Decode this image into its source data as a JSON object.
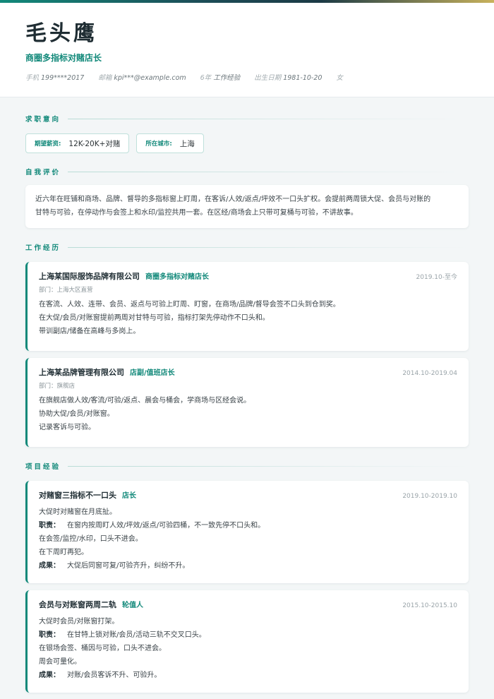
{
  "header": {
    "name": "毛头鹰",
    "title": "商圈多指标对赌店长",
    "meta": {
      "phone_label": "手机",
      "phone": "199****2017",
      "email_label": "邮箱",
      "email": "kpi***@example.com",
      "years": "6年",
      "years_label": "工作经验",
      "birth_label": "出生日期",
      "birth": "1981-10-20",
      "gender": "女"
    }
  },
  "sections": {
    "intent": "求职意向",
    "summary": "自我评价",
    "work": "工作经历",
    "projects": "项目经验"
  },
  "intent": {
    "salary_label": "期望薪资:",
    "salary": "12K-20K+对赌",
    "city_label": "所在城市:",
    "city": "上海"
  },
  "summary": {
    "line1": "近六年在旺铺和商场、品牌、督导的多指标窗上盯周，在客诉/人效/返点/坪效不一口头扩权。会提前两周锁大促、会员与对账的",
    "line2": "甘特与可验，在停动作与会签上和水印/监控共用一套。在区经/商场会上只带可复桶与可验，不讲故事。"
  },
  "work": [
    {
      "company": "上海某国际服饰品牌有限公司",
      "role": "商圈多指标对赌店长",
      "date": "2019.10-至今",
      "dept": "部门：上海大区直营",
      "lines": [
        "在客流、人效、连带、会员、返点与可验上盯周、盯窗，在商场/品牌/督导会签不口头到仓到奖。",
        "在大促/会员/对账窗提前两周对甘特与可验，指标打架先停动作不口头和。",
        "带训副店/储备在高峰与多岗上。"
      ]
    },
    {
      "company": "上海某品牌管理有限公司",
      "role": "店副/值班店长",
      "date": "2014.10-2019.04",
      "dept": "部门：旗舰店",
      "lines": [
        "在旗舰店做人效/客流/可验/返点、晨会与桶会，学商场与区经会说。",
        "协助大促/会员/对账窗。",
        "记录客诉与可验。"
      ]
    }
  ],
  "projects": [
    {
      "name": "对赌窗三指标不一口头",
      "role": "店长",
      "date": "2019.10-2019.10",
      "desc": "大促时对赌窗在月底扯。",
      "duty_label": "职责：",
      "duty": "在窗内按周盯人效/坪效/返点/可验四桶，不一致先停不口头和。",
      "extra": [
        "在会签/监控/水印，口头不进会。",
        "在下周盯再犯。"
      ],
      "result_label": "成果：",
      "result": "大促后同窗可复/可验齐升，纠纷不升。"
    },
    {
      "name": "会员与对账窗两周二轨",
      "role": "轮值人",
      "date": "2015.10-2015.10",
      "desc": "大促时会员/对账窗打架。",
      "duty_label": "职责：",
      "duty": "在甘特上锁对账/会员/活动三轨不交叉口头。",
      "extra": [
        "在银场会签、桶因与可验，口头不进会。",
        "周会可量化。"
      ],
      "result_label": "成果：",
      "result": "对账/会员客诉不升、可验升。"
    }
  ]
}
